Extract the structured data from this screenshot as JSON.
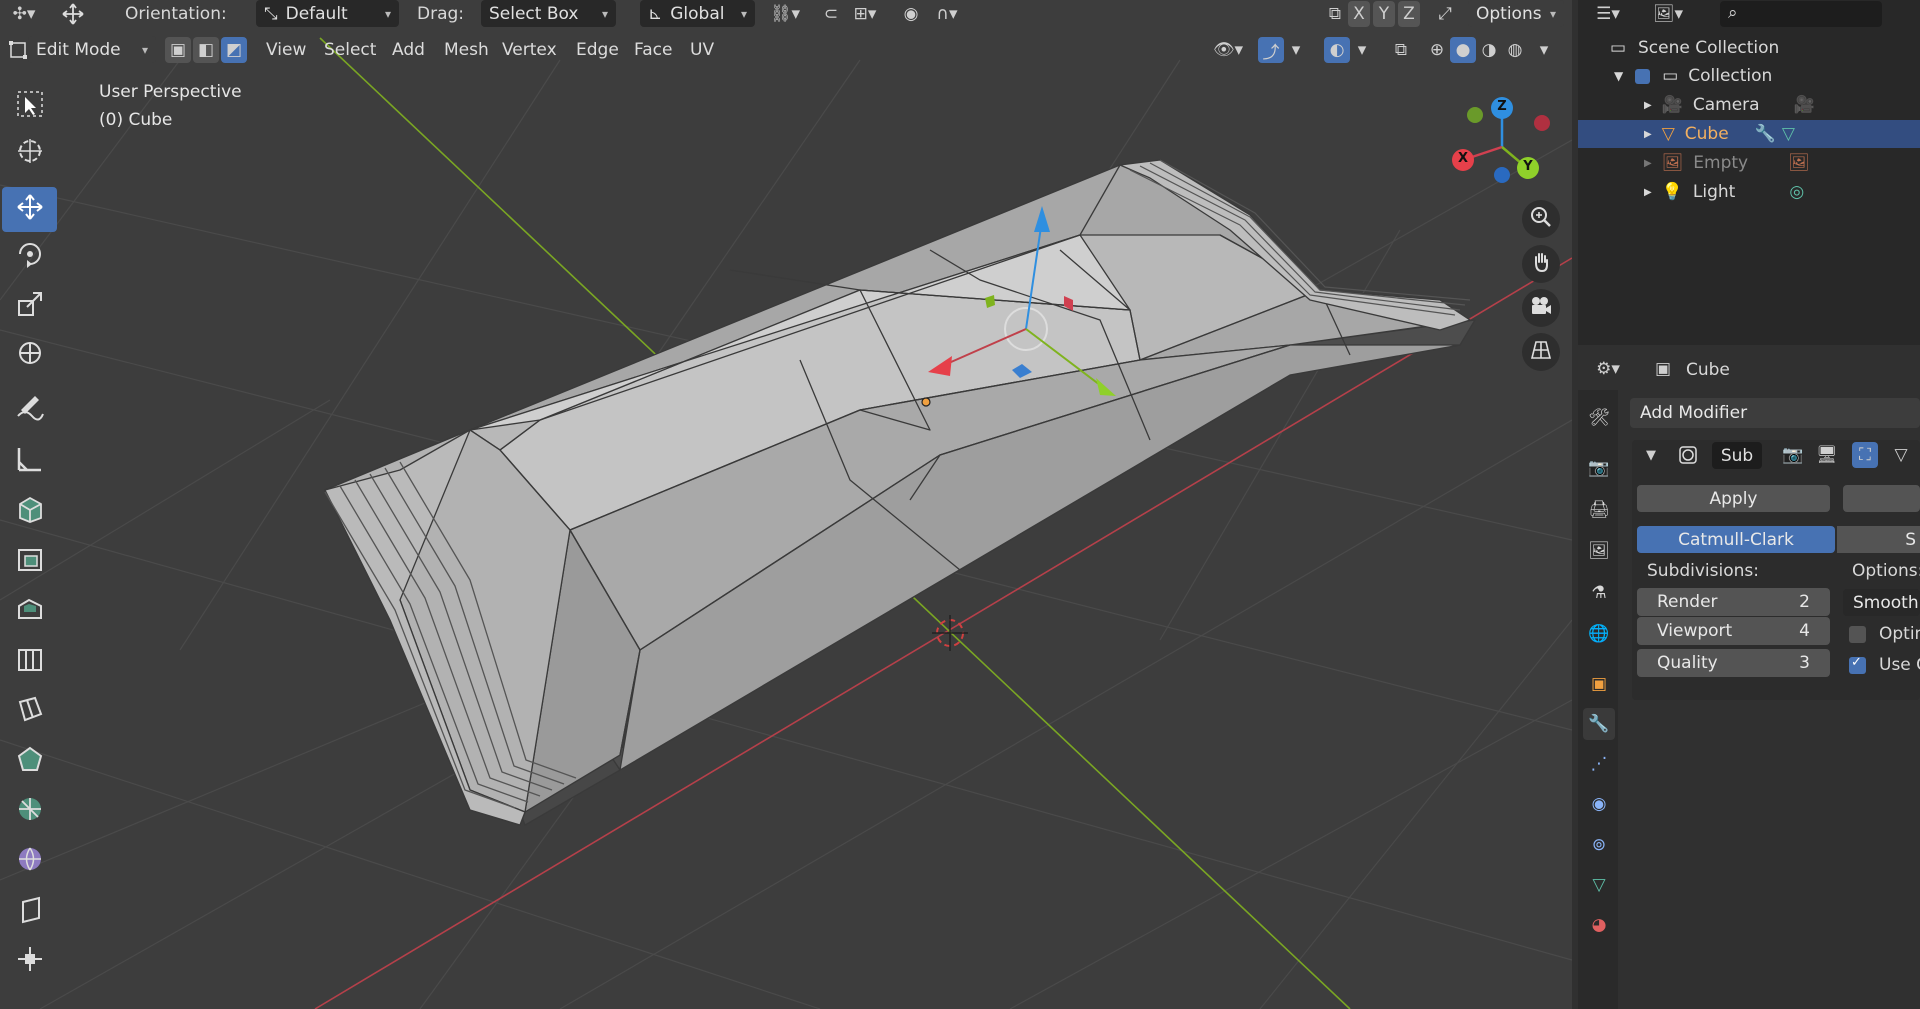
{
  "header": {
    "orientation_label": "Orientation:",
    "orientation_value": "Default",
    "drag_label": "Drag:",
    "drag_value": "Select Box",
    "transform_space": "Global",
    "axis_x": "X",
    "axis_y": "Y",
    "axis_z": "Z",
    "options_label": "Options"
  },
  "header2": {
    "mode": "Edit Mode",
    "menus": [
      "View",
      "Select",
      "Add",
      "Mesh",
      "Vertex",
      "Edge",
      "Face",
      "UV"
    ]
  },
  "viewport": {
    "perspective": "User Perspective",
    "object_info": "(0) Cube",
    "gizmo_x": "X",
    "gizmo_y": "Y",
    "gizmo_z": "Z"
  },
  "outliner": {
    "root": "Scene Collection",
    "collection": "Collection",
    "items": [
      {
        "label": "Camera"
      },
      {
        "label": "Cube"
      },
      {
        "label": "Empty"
      },
      {
        "label": "Light"
      }
    ]
  },
  "properties": {
    "object_name": "Cube",
    "add_modifier": "Add Modifier",
    "modifier_name": "Sub",
    "apply_label": "Apply",
    "algo_selected": "Catmull-Clark",
    "algo_other": "S",
    "subdivisions_label": "Subdivisions:",
    "options_label": "Options:",
    "render_label": "Render",
    "render_value": "2",
    "viewport_label": "Viewport",
    "viewport_value": "4",
    "quality_label": "Quality",
    "quality_value": "3",
    "smooth_value": "Smooth,",
    "optimal_label": "Optim",
    "usec_label": "Use C"
  },
  "colors": {
    "accent": "#4772b3",
    "viewport_bg": "#3d3d3d",
    "x_axis": "#c0404a",
    "y_axis": "#7fb31e",
    "z_axis": "#2f8fe0"
  }
}
